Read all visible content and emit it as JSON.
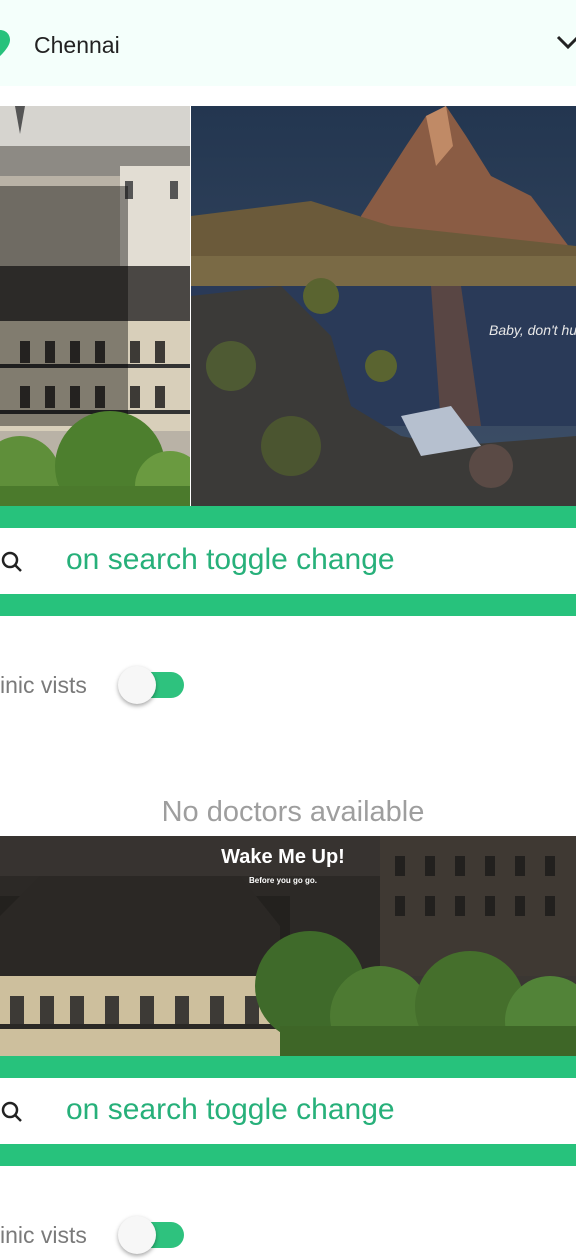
{
  "location": {
    "city": "Chennai"
  },
  "banners": {
    "lake_caption": "Baby, don't hu",
    "wake_title": "Wake Me Up!",
    "wake_subtitle": "Before you go go."
  },
  "search": {
    "label": "on search toggle change"
  },
  "filter": {
    "toggle_label": "inic vists",
    "toggle_on": true
  },
  "results": {
    "empty_message": "No doctors available"
  },
  "colors": {
    "accent": "#27c27c",
    "search_text": "#27b07a"
  }
}
